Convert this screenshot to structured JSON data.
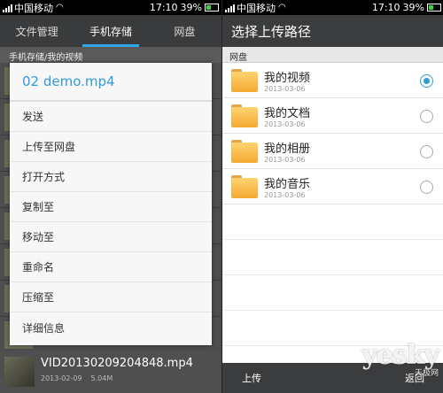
{
  "status": {
    "carrier": "中国移动",
    "time": "17:10",
    "battery": "39%"
  },
  "left": {
    "tabs": [
      {
        "label": "文件管理"
      },
      {
        "label": "手机存储"
      },
      {
        "label": "网盘"
      }
    ],
    "active_tab": 1,
    "path": "手机存储/我的视频",
    "dialog": {
      "title": "02 demo.mp4",
      "items": [
        {
          "label": "发送"
        },
        {
          "label": "上传至网盘"
        },
        {
          "label": "打开方式"
        },
        {
          "label": "复制至"
        },
        {
          "label": "移动至"
        },
        {
          "label": "重命名"
        },
        {
          "label": "压缩至"
        },
        {
          "label": "详细信息"
        }
      ]
    },
    "bottom_file": {
      "name": "VID20130209204848.mp4",
      "date": "2013-02-09",
      "size": "5.04M"
    }
  },
  "right": {
    "title": "选择上传路径",
    "section": "网盘",
    "folders": [
      {
        "name": "我的视频",
        "date": "2013-03-06",
        "selected": true
      },
      {
        "name": "我的文档",
        "date": "2013-03-06",
        "selected": false
      },
      {
        "name": "我的相册",
        "date": "2013-03-06",
        "selected": false
      },
      {
        "name": "我的音乐",
        "date": "2013-03-06",
        "selected": false
      }
    ],
    "bottom": {
      "upload_label": "上传",
      "back_label": "返回"
    },
    "watermark": {
      "logo": "yesky",
      "sub": "天极网"
    }
  },
  "colors": {
    "accent": "#2f9bd8",
    "header_bg": "#3b3c3e",
    "folder": "#f4a932"
  }
}
